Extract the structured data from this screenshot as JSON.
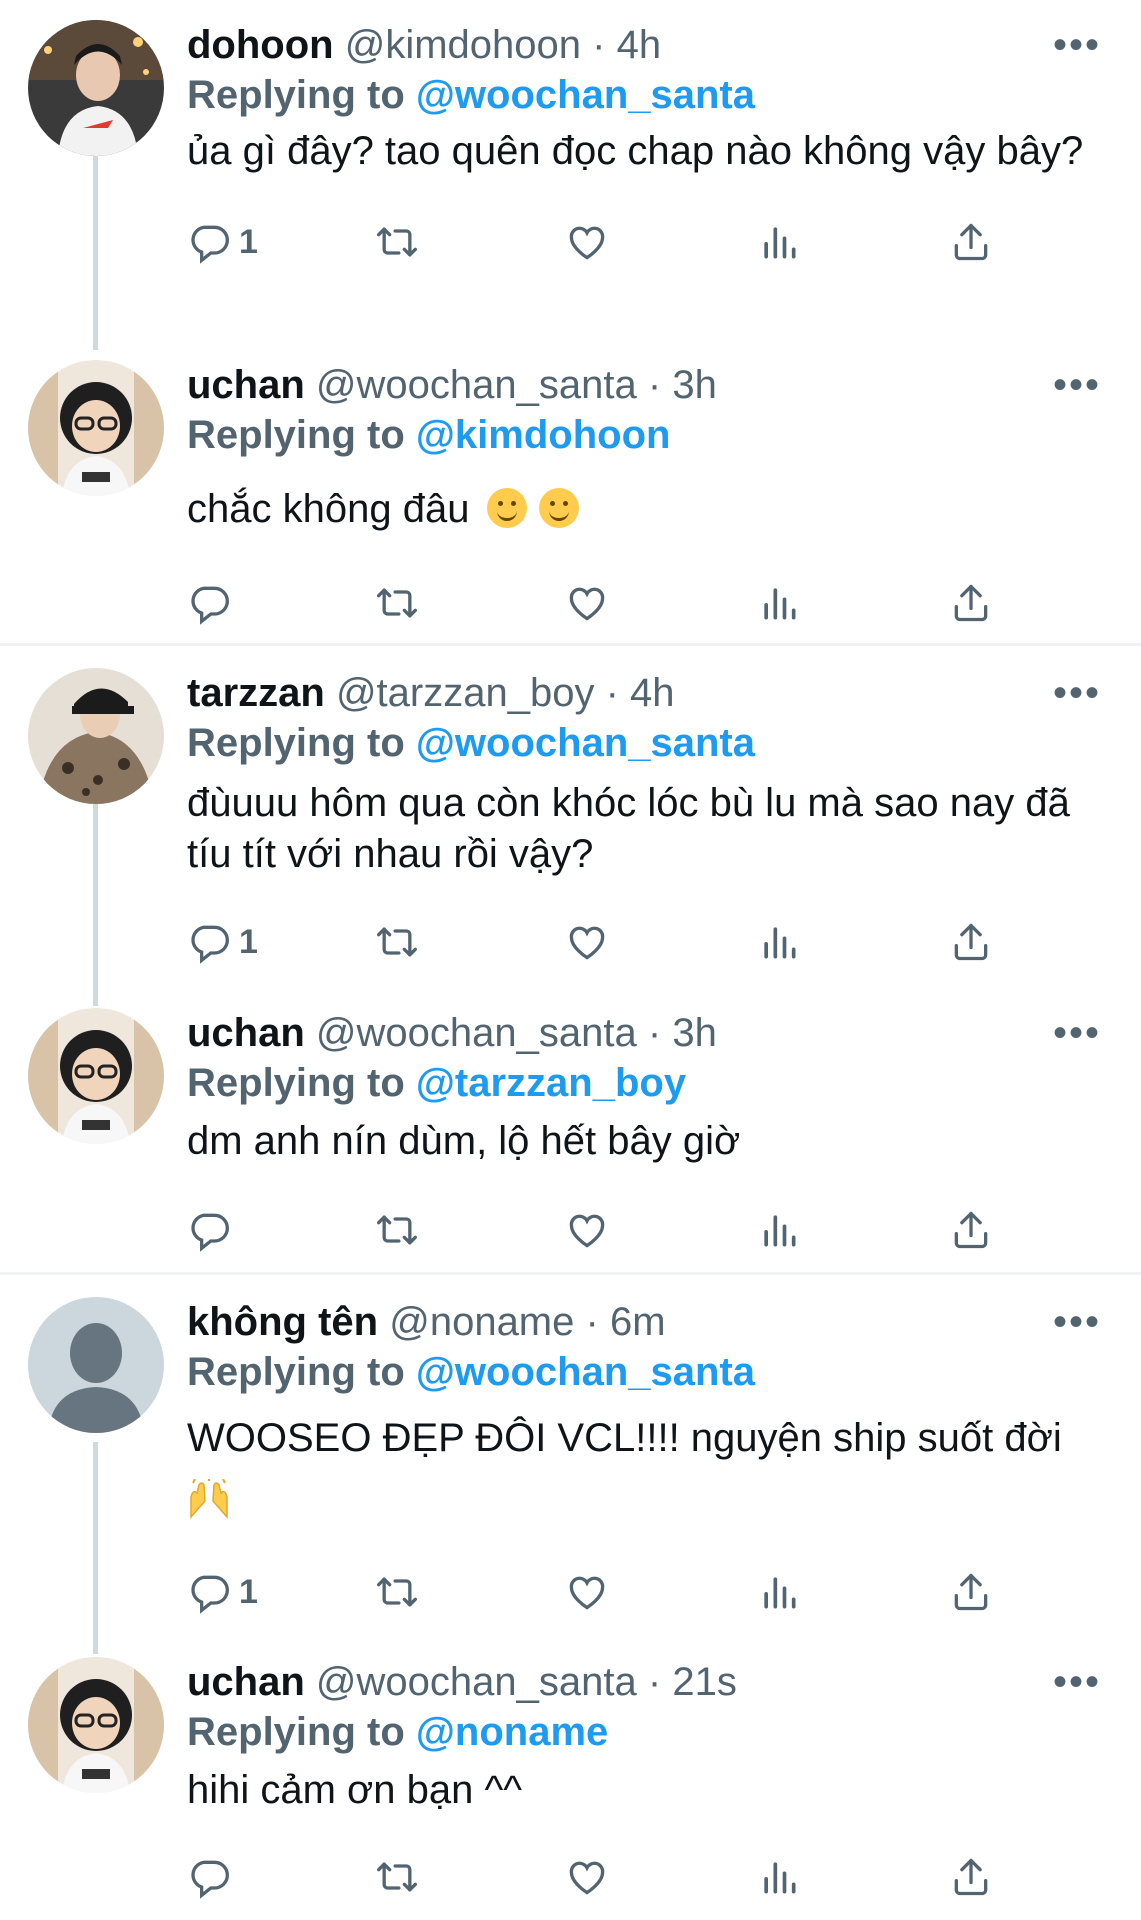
{
  "tweets": [
    {
      "name": "dohoon",
      "handle": "@kimdohoon",
      "time": "4h",
      "replying_label": "Replying to",
      "mention": "@woochan_santa",
      "text": "ủa gì đây? tao quên đọc chap nào không vậy bây?",
      "reply_count": "1"
    },
    {
      "name": "uchan",
      "handle": "@woochan_santa",
      "time": "3h",
      "replying_label": "Replying to",
      "mention": "@kimdohoon",
      "text": "chắc không đâu",
      "emoji": [
        "smiling-face-emoji",
        "smiling-face-emoji"
      ],
      "reply_count": ""
    },
    {
      "name": "tarzzan",
      "handle": "@tarzzan_boy",
      "time": "4h",
      "replying_label": "Replying to",
      "mention": "@woochan_santa",
      "text": "đùuuu hôm qua còn khóc lóc bù lu mà sao nay đã tíu tít với nhau rồi vậy?",
      "reply_count": "1"
    },
    {
      "name": "uchan",
      "handle": "@woochan_santa",
      "time": "3h",
      "replying_label": "Replying to",
      "mention": "@tarzzan_boy",
      "text": "dm anh nín dùm, lộ hết bây giờ",
      "reply_count": ""
    },
    {
      "name": "không tên",
      "handle": "@noname",
      "time": "6m",
      "replying_label": "Replying to",
      "mention": "@woochan_santa",
      "text": "WOOSEO ĐẸP ĐÔI VCL!!!! nguyện ship suốt đời",
      "emoji": [
        "raising-hands-emoji"
      ],
      "reply_count": "1"
    },
    {
      "name": "uchan",
      "handle": "@woochan_santa",
      "time": "21s",
      "replying_label": "Replying to",
      "mention": "@noname",
      "text": "hihi cảm ơn bạn ^^",
      "reply_count": ""
    }
  ],
  "separator": "·",
  "more_label": "•••",
  "colors": {
    "accent": "#1d9bf0",
    "muted": "#536471",
    "text": "#0f1419",
    "line": "#cfd9de"
  },
  "icons": [
    "more-icon",
    "reply-icon",
    "retweet-icon",
    "like-icon",
    "views-icon",
    "share-icon"
  ]
}
